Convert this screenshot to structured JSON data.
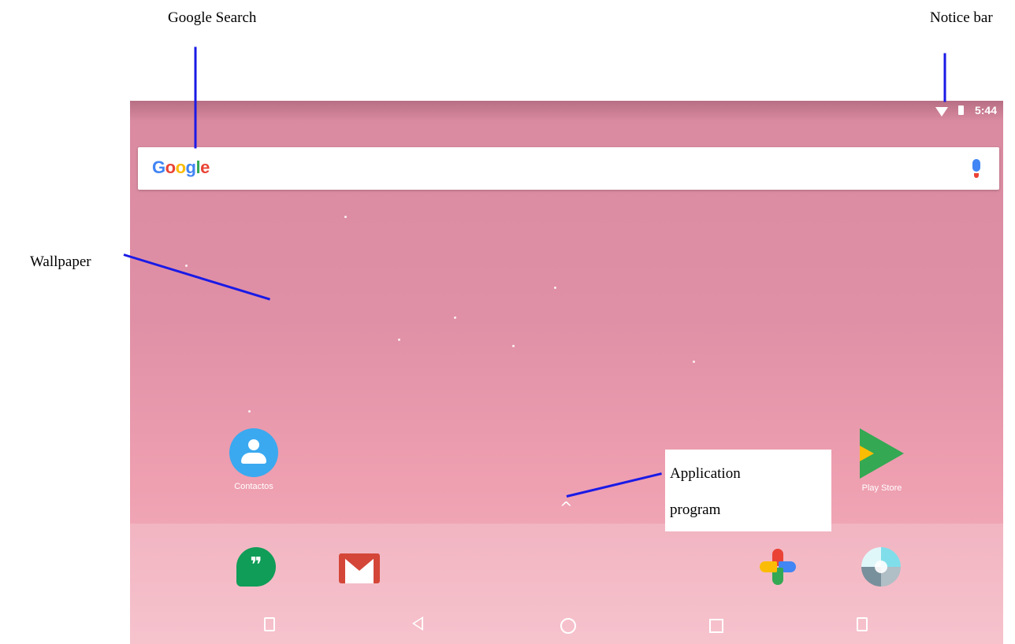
{
  "callouts": {
    "google_search": "Google Search",
    "notice_bar": "Notice bar",
    "wallpaper": "Wallpaper",
    "app_program_line1": "Application",
    "app_program_line2": "program"
  },
  "status_bar": {
    "time": "5:44",
    "icons": [
      "wifi-icon",
      "battery-icon"
    ]
  },
  "search": {
    "logo": "Google",
    "logo_colors": [
      "#4285f4",
      "#ea4335",
      "#fbbc05",
      "#4285f4",
      "#34a853",
      "#ea4335"
    ],
    "mic_icon": "mic-icon"
  },
  "home_apps": [
    {
      "label": "Contactos",
      "icon": "contacts-icon"
    },
    {
      "label": "Play Store",
      "icon": "play-store-icon"
    }
  ],
  "app_drawer_arrow": "^",
  "dock": [
    {
      "icon": "hangouts-icon",
      "glyph": "❞"
    },
    {
      "icon": "gmail-icon"
    },
    {
      "icon": "photos-icon"
    },
    {
      "icon": "camera-icon"
    }
  ],
  "nav_bar": [
    "volume-down-icon",
    "back-icon",
    "home-icon",
    "recents-icon",
    "volume-up-icon"
  ],
  "colors": {
    "annotation_line": "#1a1ae6",
    "wallpaper": "#e090a6"
  }
}
